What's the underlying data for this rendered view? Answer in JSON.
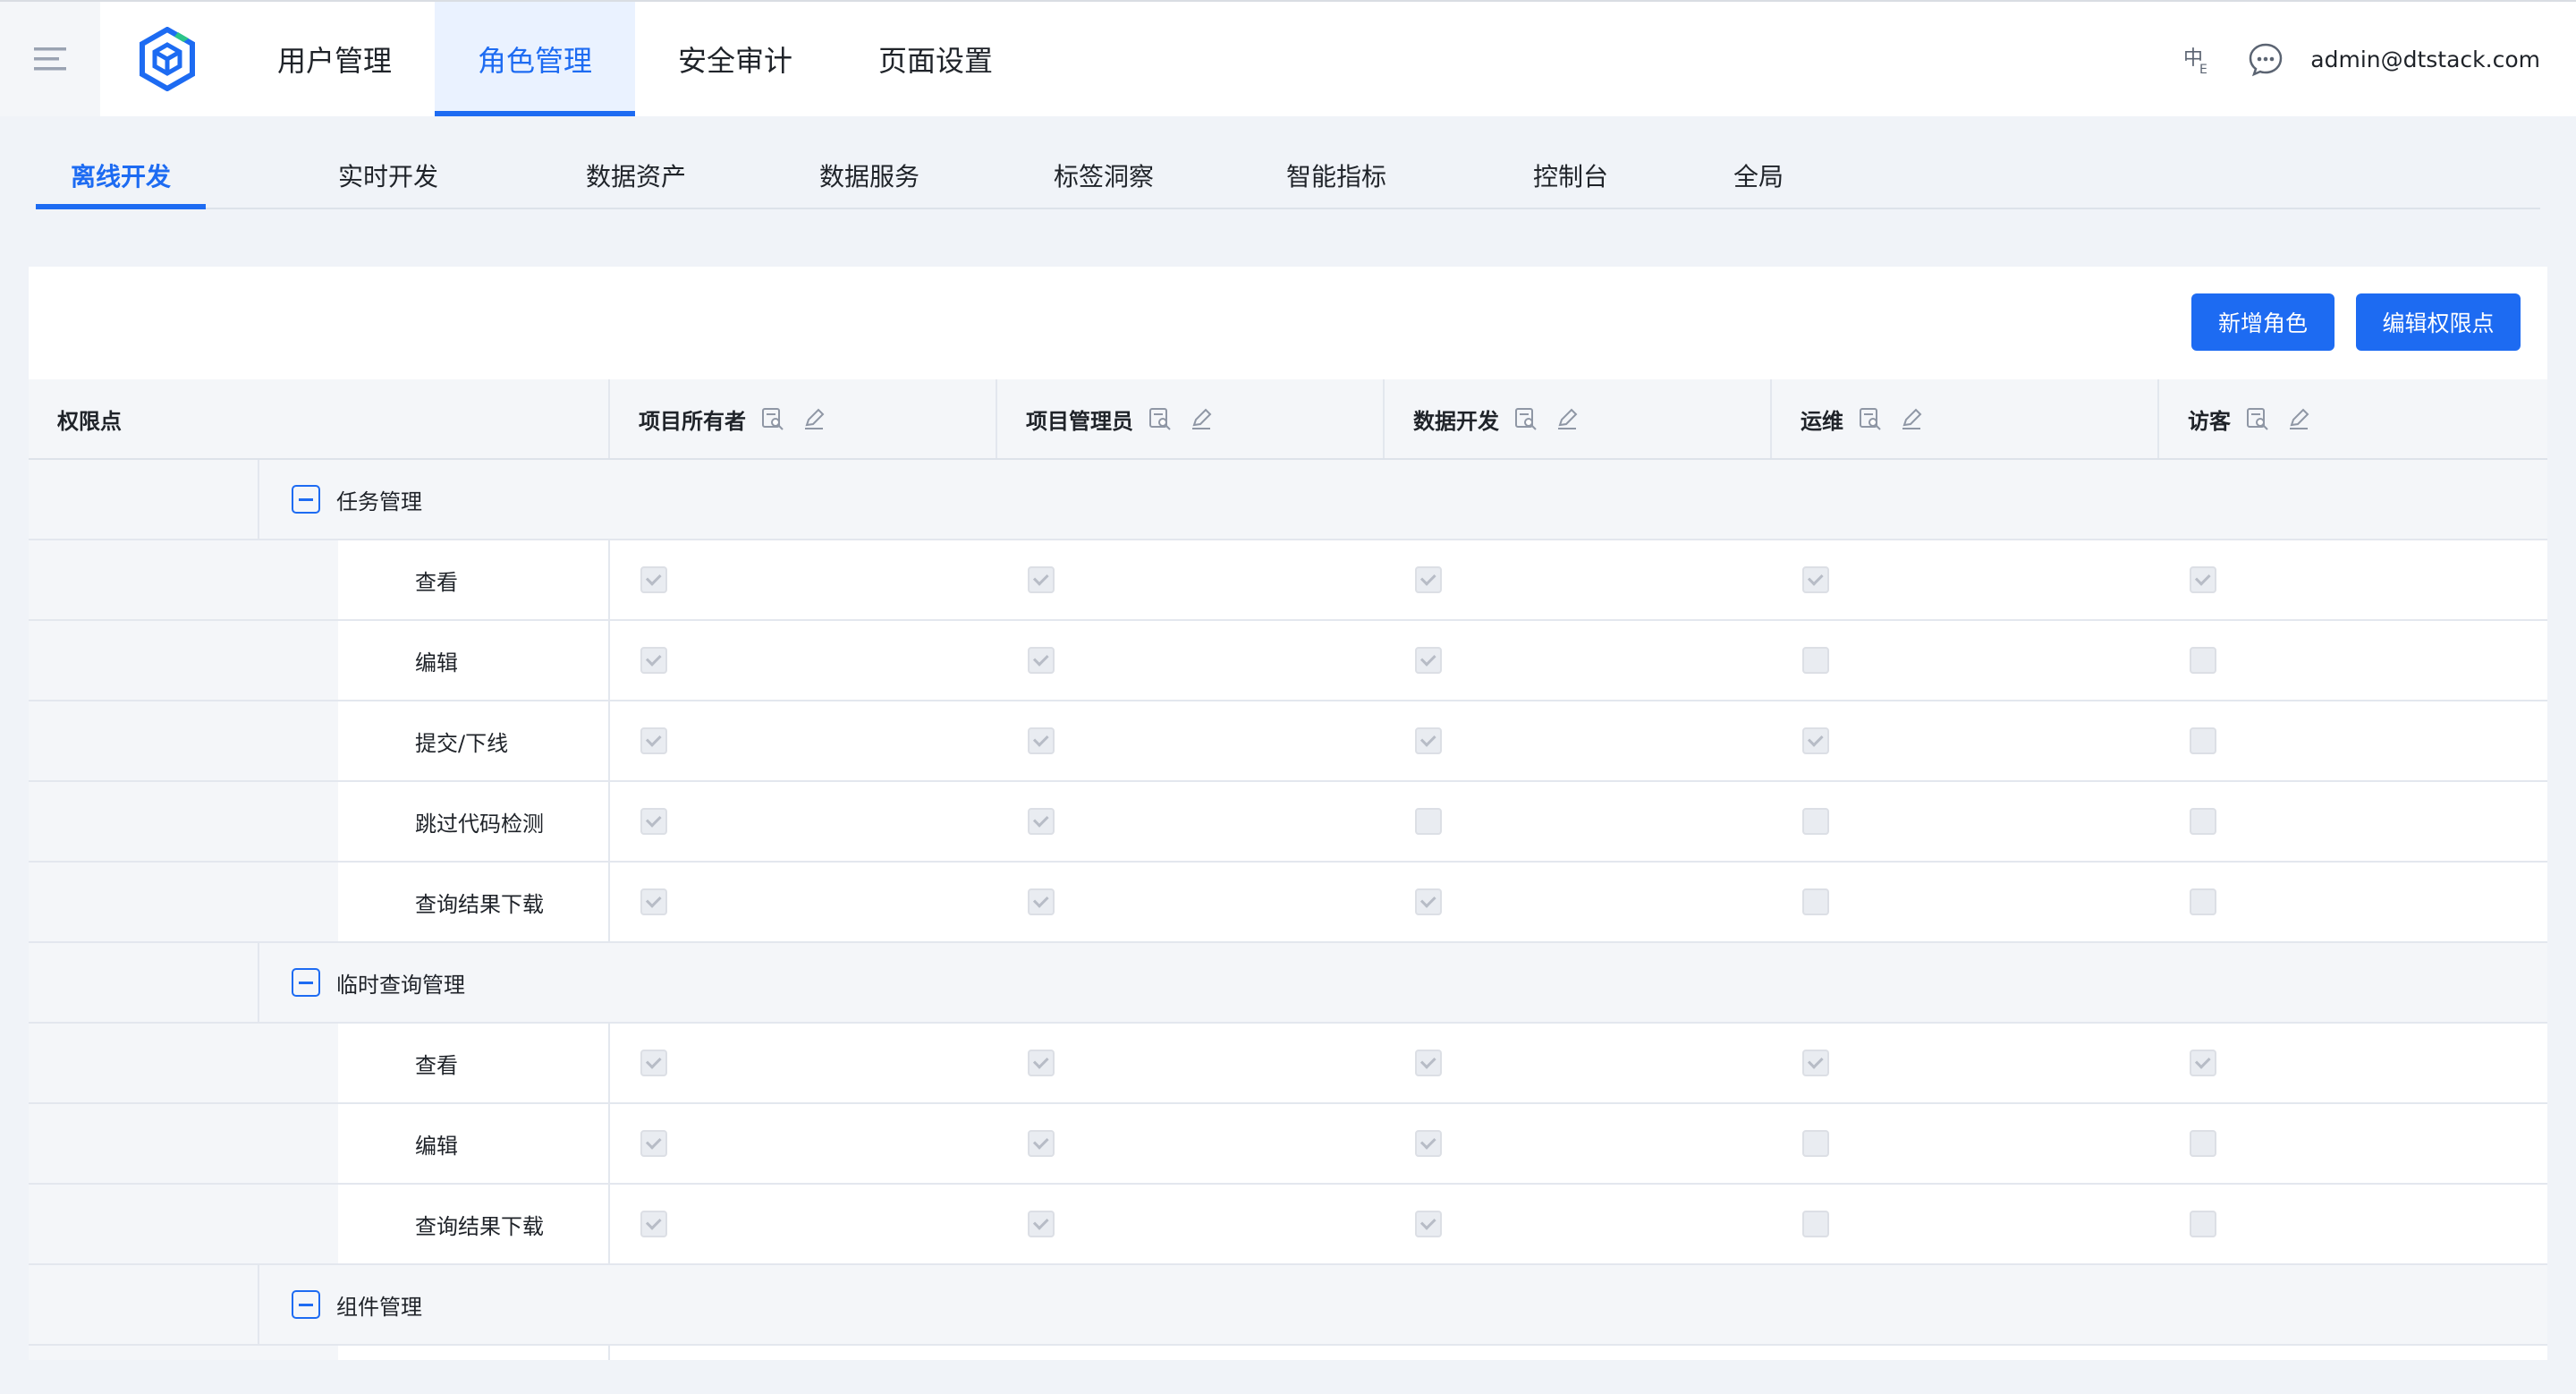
{
  "header": {
    "nav": [
      "用户管理",
      "角色管理",
      "安全审计",
      "页面设置"
    ],
    "active_index": 1,
    "user_email": "admin@dtstack.com",
    "accent_color": "#1d6bf2"
  },
  "subtabs": {
    "items": [
      "离线开发",
      "实时开发",
      "数据资产",
      "数据服务",
      "标签洞察",
      "智能指标",
      "控制台",
      "全局"
    ],
    "active_index": 0
  },
  "actions": {
    "add_role": "新增角色",
    "edit_permissions": "编辑权限点"
  },
  "table": {
    "first_header": "权限点",
    "roles": [
      "项目所有者",
      "项目管理员",
      "数据开发",
      "运维",
      "访客"
    ],
    "groups": [
      {
        "name": "任务管理",
        "items": [
          {
            "name": "查看",
            "checks": [
              true,
              true,
              true,
              true,
              true
            ]
          },
          {
            "name": "编辑",
            "checks": [
              true,
              true,
              true,
              false,
              false
            ]
          },
          {
            "name": "提交/下线",
            "checks": [
              true,
              true,
              true,
              true,
              false
            ]
          },
          {
            "name": "跳过代码检测",
            "checks": [
              true,
              true,
              false,
              false,
              false
            ]
          },
          {
            "name": "查询结果下载",
            "checks": [
              true,
              true,
              true,
              false,
              false
            ]
          }
        ]
      },
      {
        "name": "临时查询管理",
        "items": [
          {
            "name": "查看",
            "checks": [
              true,
              true,
              true,
              true,
              true
            ]
          },
          {
            "name": "编辑",
            "checks": [
              true,
              true,
              true,
              false,
              false
            ]
          },
          {
            "name": "查询结果下载",
            "checks": [
              true,
              true,
              true,
              false,
              false
            ]
          }
        ]
      },
      {
        "name": "组件管理",
        "items": []
      }
    ]
  }
}
